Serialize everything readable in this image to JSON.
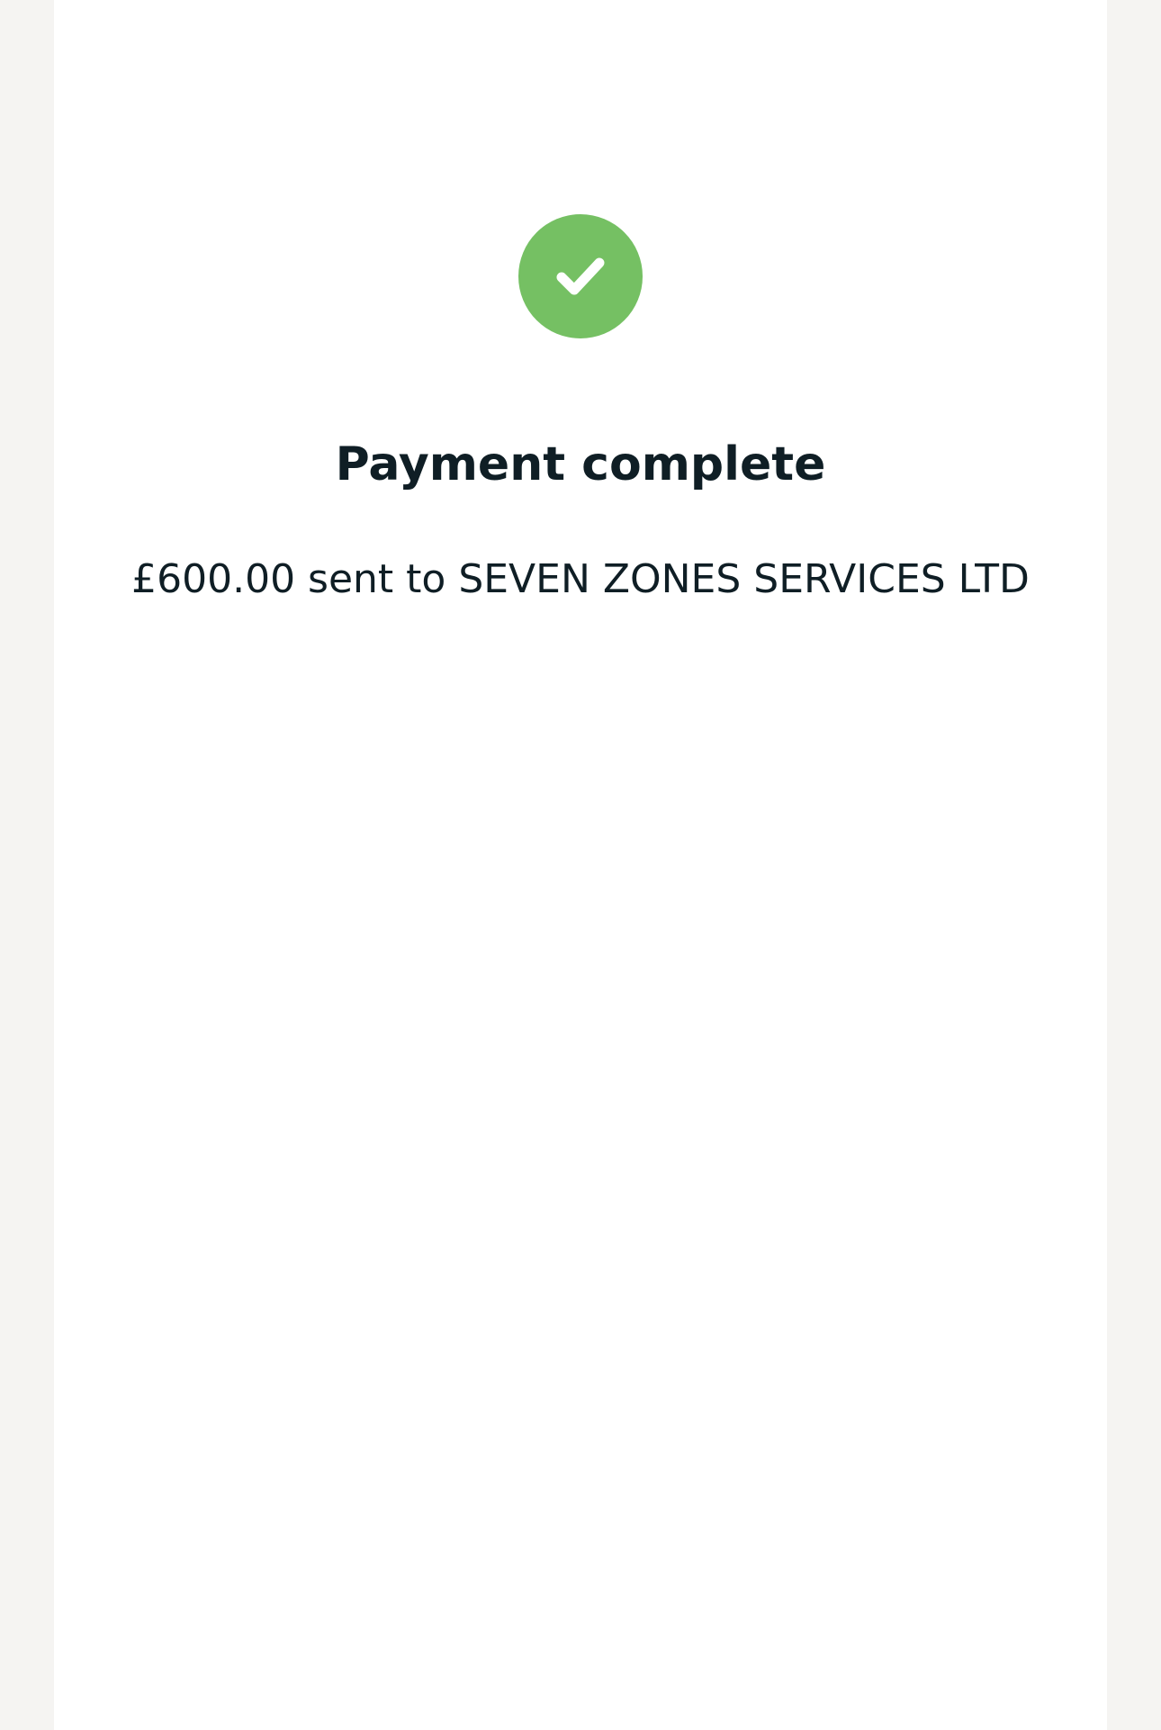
{
  "colors": {
    "success": "#75c063",
    "text": "#0f1e25",
    "background": "#f5f4f2",
    "card": "#ffffff"
  },
  "status": {
    "icon": "check-circle-icon",
    "title": "Payment complete",
    "message": "£600.00 sent to SEVEN ZONES SERVICES LTD"
  }
}
